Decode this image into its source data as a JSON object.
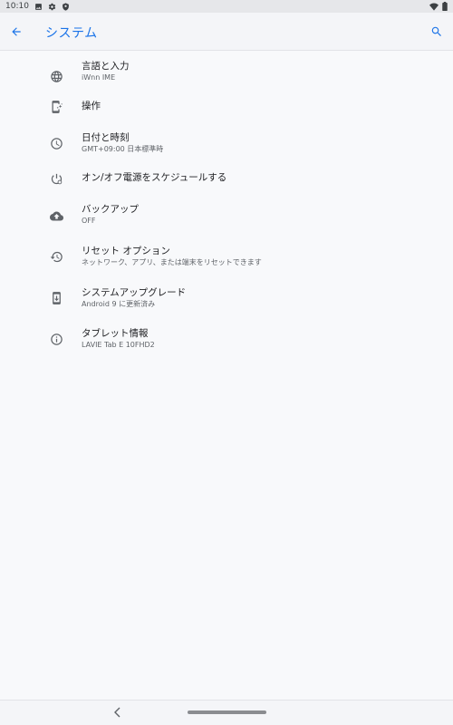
{
  "status_bar": {
    "time": "10:10",
    "icons": [
      "image-icon",
      "settings-gear-icon",
      "shield-icon",
      "wifi-icon",
      "battery-icon"
    ]
  },
  "app_bar": {
    "title": "システム",
    "back_icon": "arrow-back-icon",
    "search_icon": "search-icon",
    "accent_color": "#1a73e8"
  },
  "settings": {
    "items": [
      {
        "title": "言語と入力",
        "summary": "iWnn IME",
        "icon": "globe-icon"
      },
      {
        "title": "操作",
        "summary": "",
        "icon": "gestures-icon"
      },
      {
        "title": "日付と時刻",
        "summary": "GMT+09:00 日本標準時",
        "icon": "clock-icon"
      },
      {
        "title": "オン/オフ電源をスケジュールする",
        "summary": "",
        "icon": "power-schedule-icon"
      },
      {
        "title": "バックアップ",
        "summary": "OFF",
        "icon": "cloud-upload-icon"
      },
      {
        "title": "リセット オプション",
        "summary": "ネットワーク、アプリ、または端末をリセットできます",
        "icon": "history-icon"
      },
      {
        "title": "システムアップグレード",
        "summary": "Android 9 に更新済み",
        "icon": "system-update-icon"
      },
      {
        "title": "タブレット情報",
        "summary": "LAVIE Tab E 10FHD2",
        "icon": "info-icon"
      }
    ]
  },
  "nav_bar": {
    "back_icon": "chevron-left-icon",
    "home_indicator": "home-pill"
  }
}
